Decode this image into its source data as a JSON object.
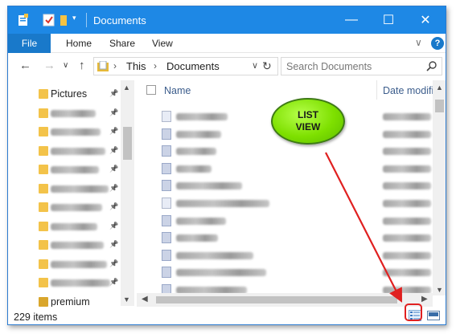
{
  "window": {
    "title": "Documents",
    "controls": {
      "minimize": "—",
      "maximize": "☐",
      "close": "✕"
    }
  },
  "ribbon": {
    "file_tab": "File",
    "tabs": [
      "Home",
      "Share",
      "View"
    ],
    "help": "?",
    "collapse": "∨"
  },
  "address": {
    "back": "←",
    "forward": "→",
    "recent": "∨",
    "up": "↑",
    "crumbs": [
      "This",
      "Documents"
    ],
    "separator": "›",
    "dropdown": "∨",
    "refresh": "↻"
  },
  "search": {
    "placeholder": "Search Documents"
  },
  "nav": {
    "items": [
      {
        "label": "Pictures",
        "blurred": false,
        "pinned": true
      },
      {
        "label": "",
        "blurred": true,
        "pinned": true
      },
      {
        "label": "",
        "blurred": true,
        "pinned": true
      },
      {
        "label": "",
        "blurred": true,
        "pinned": true
      },
      {
        "label": "",
        "blurred": true,
        "pinned": true
      },
      {
        "label": "",
        "blurred": true,
        "pinned": true
      },
      {
        "label": "",
        "blurred": true,
        "pinned": true
      },
      {
        "label": "",
        "blurred": true,
        "pinned": true
      },
      {
        "label": "",
        "blurred": true,
        "pinned": true
      },
      {
        "label": "",
        "blurred": true,
        "pinned": true
      },
      {
        "label": "",
        "blurred": true,
        "pinned": true
      },
      {
        "label": "premium",
        "blurred": false,
        "pinned": false
      }
    ]
  },
  "list": {
    "columns": [
      "Name",
      "Date modifi"
    ],
    "rows": [
      {
        "icon": "folder-doc-icon"
      },
      {
        "icon": "file-icon"
      },
      {
        "icon": "file-icon"
      },
      {
        "icon": "file-icon"
      },
      {
        "icon": "file-icon"
      },
      {
        "icon": "doc-icon"
      },
      {
        "icon": "file-icon"
      },
      {
        "icon": "file-icon"
      },
      {
        "icon": "file-icon"
      },
      {
        "icon": "file-icon"
      },
      {
        "icon": "file-icon"
      }
    ]
  },
  "status": {
    "count": "229 items"
  },
  "callout": {
    "line1": "LIST",
    "line2": "VIEW"
  },
  "colors": {
    "accent": "#1e88e5",
    "file_tab": "#1979ca",
    "callout": "#7ee000",
    "annotation": "#e02020"
  }
}
